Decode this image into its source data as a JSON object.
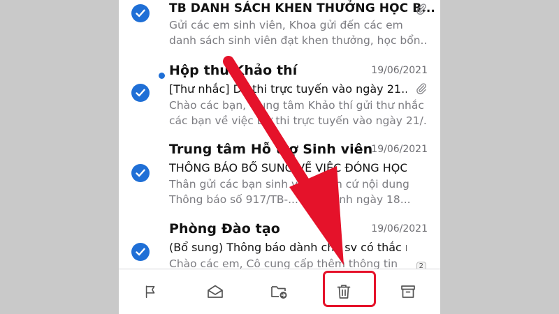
{
  "mails": [
    {
      "sender": "TB DANH SÁCH KHEN THƯỞNG HỌC B...",
      "preview1": "Gửi các em sinh viên, Khoa gửi đến các em",
      "preview2": "danh sách sinh viên đạt khen thưởng, học bổn...",
      "checked": true,
      "attachment": true
    },
    {
      "sender": "Hộp thư Khảo thí",
      "date": "19/06/2021",
      "subject": "[Thư nhắc] Dự thi trực tuyến vào ngày 21...",
      "preview1": "Chào các bạn, Trung tâm Khảo thí gửi thư nhắc",
      "preview2": "các bạn về việc Dự thi trực tuyến vào ngày 21/...",
      "checked": true,
      "unread": true,
      "attachment": true
    },
    {
      "sender": "Trung tâm Hỗ trợ Sinh viên",
      "date": "19/06/2021",
      "subject": "THÔNG BÁO BỔ SUNG VỀ VIỆC ĐÓNG HỌC P...",
      "preview1": "Thân gửi các bạn sinh viên, Căn cứ nội dung",
      "preview2": "Thông báo số 917/TB-... ban hành ngày 18...",
      "checked": true
    },
    {
      "sender": "Phòng Đào tạo",
      "date": "19/06/2021",
      "subject": "(Bổ sung) Thông báo dành cho sv có thắc mắc...",
      "preview1": "Chào các em, Cô cung cấp thêm thông tin",
      "checked": true,
      "badge": "2"
    }
  ],
  "toolbar": {
    "items": [
      {
        "name": "flag-icon",
        "label": "Flag"
      },
      {
        "name": "mark-read-icon",
        "label": "Mark as read"
      },
      {
        "name": "move-folder-icon",
        "label": "Move"
      },
      {
        "name": "trash-icon",
        "label": "Delete"
      },
      {
        "name": "archive-icon",
        "label": "Archive"
      }
    ]
  },
  "colors": {
    "accent": "#1f6fd6",
    "annotation": "#e5122a",
    "background": "#c9c9c9"
  }
}
